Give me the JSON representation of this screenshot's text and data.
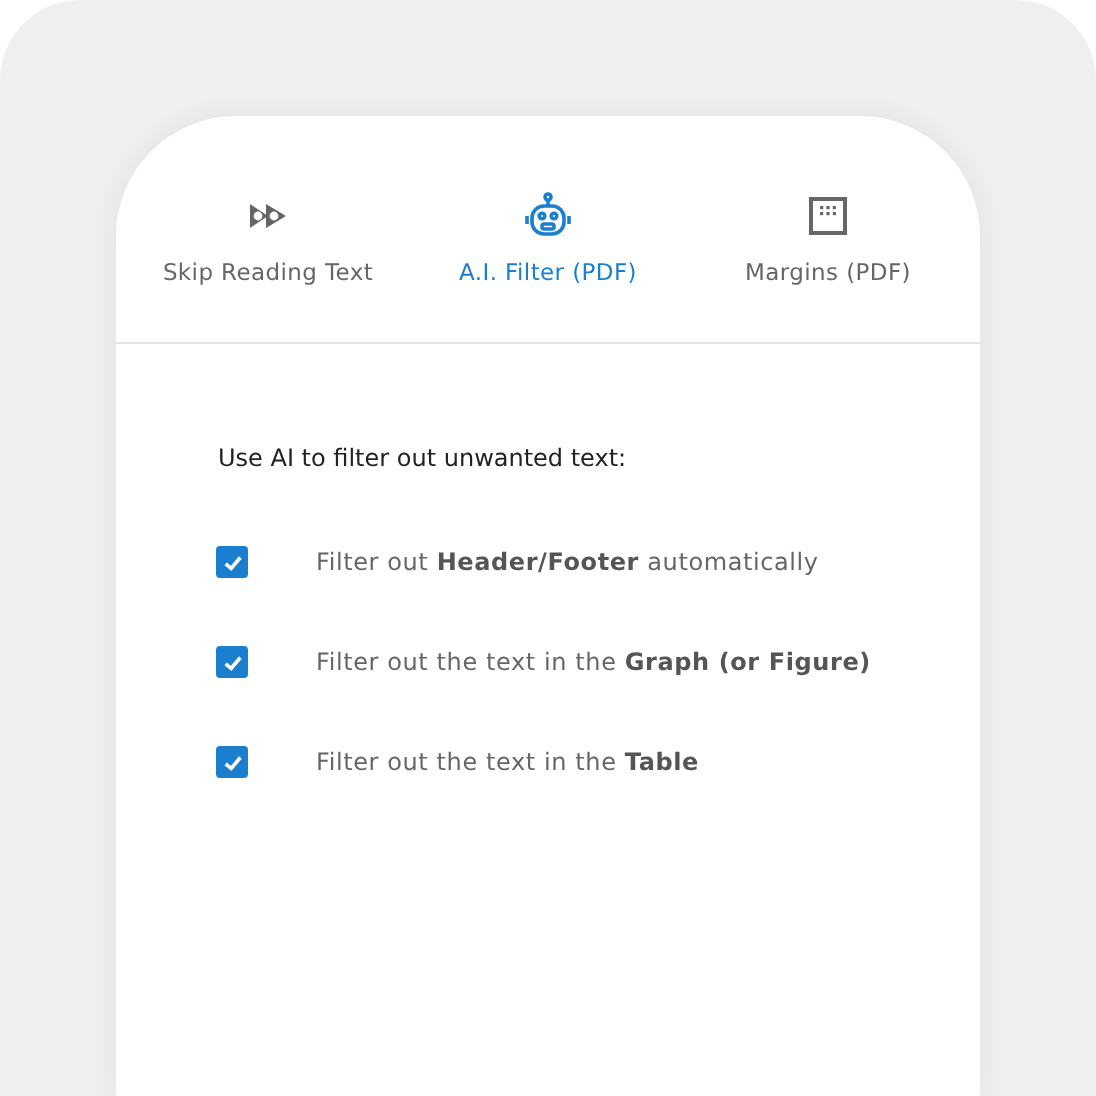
{
  "tabs": [
    {
      "label": "Skip Reading Text",
      "kind": "skip",
      "selected": false
    },
    {
      "label": "A.I. Filter (PDF)",
      "kind": "robot",
      "selected": true
    },
    {
      "label": "Margins (PDF)",
      "kind": "margins",
      "selected": false
    }
  ],
  "heading": "Use AI to filter out unwanted text:",
  "options": [
    {
      "text": "Filter out **Header/Footer** automatically",
      "checked": true
    },
    {
      "text": "Filter out the text in the **Graph (or Figure)**",
      "checked": true
    },
    {
      "text": "Filter out the text in the **Table**",
      "checked": true
    }
  ]
}
